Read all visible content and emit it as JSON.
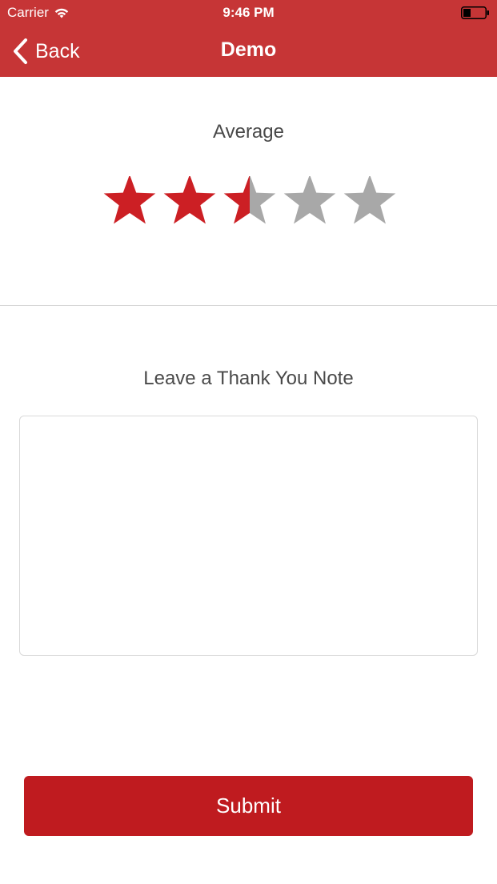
{
  "status_bar": {
    "carrier": "Carrier",
    "time": "9:46 PM",
    "icons": [
      "wifi-icon",
      "battery-icon"
    ]
  },
  "navbar": {
    "back_label": "Back",
    "title": "Demo",
    "background": "#c63536"
  },
  "rating": {
    "title": "Average",
    "value": 2.5,
    "max": 5,
    "filled_color": "#cc1f24",
    "empty_color": "#a8a8a8"
  },
  "note": {
    "title": "Leave a Thank You Note",
    "value": "",
    "placeholder": ""
  },
  "submit": {
    "label": "Submit",
    "background": "#bf1b1f"
  }
}
